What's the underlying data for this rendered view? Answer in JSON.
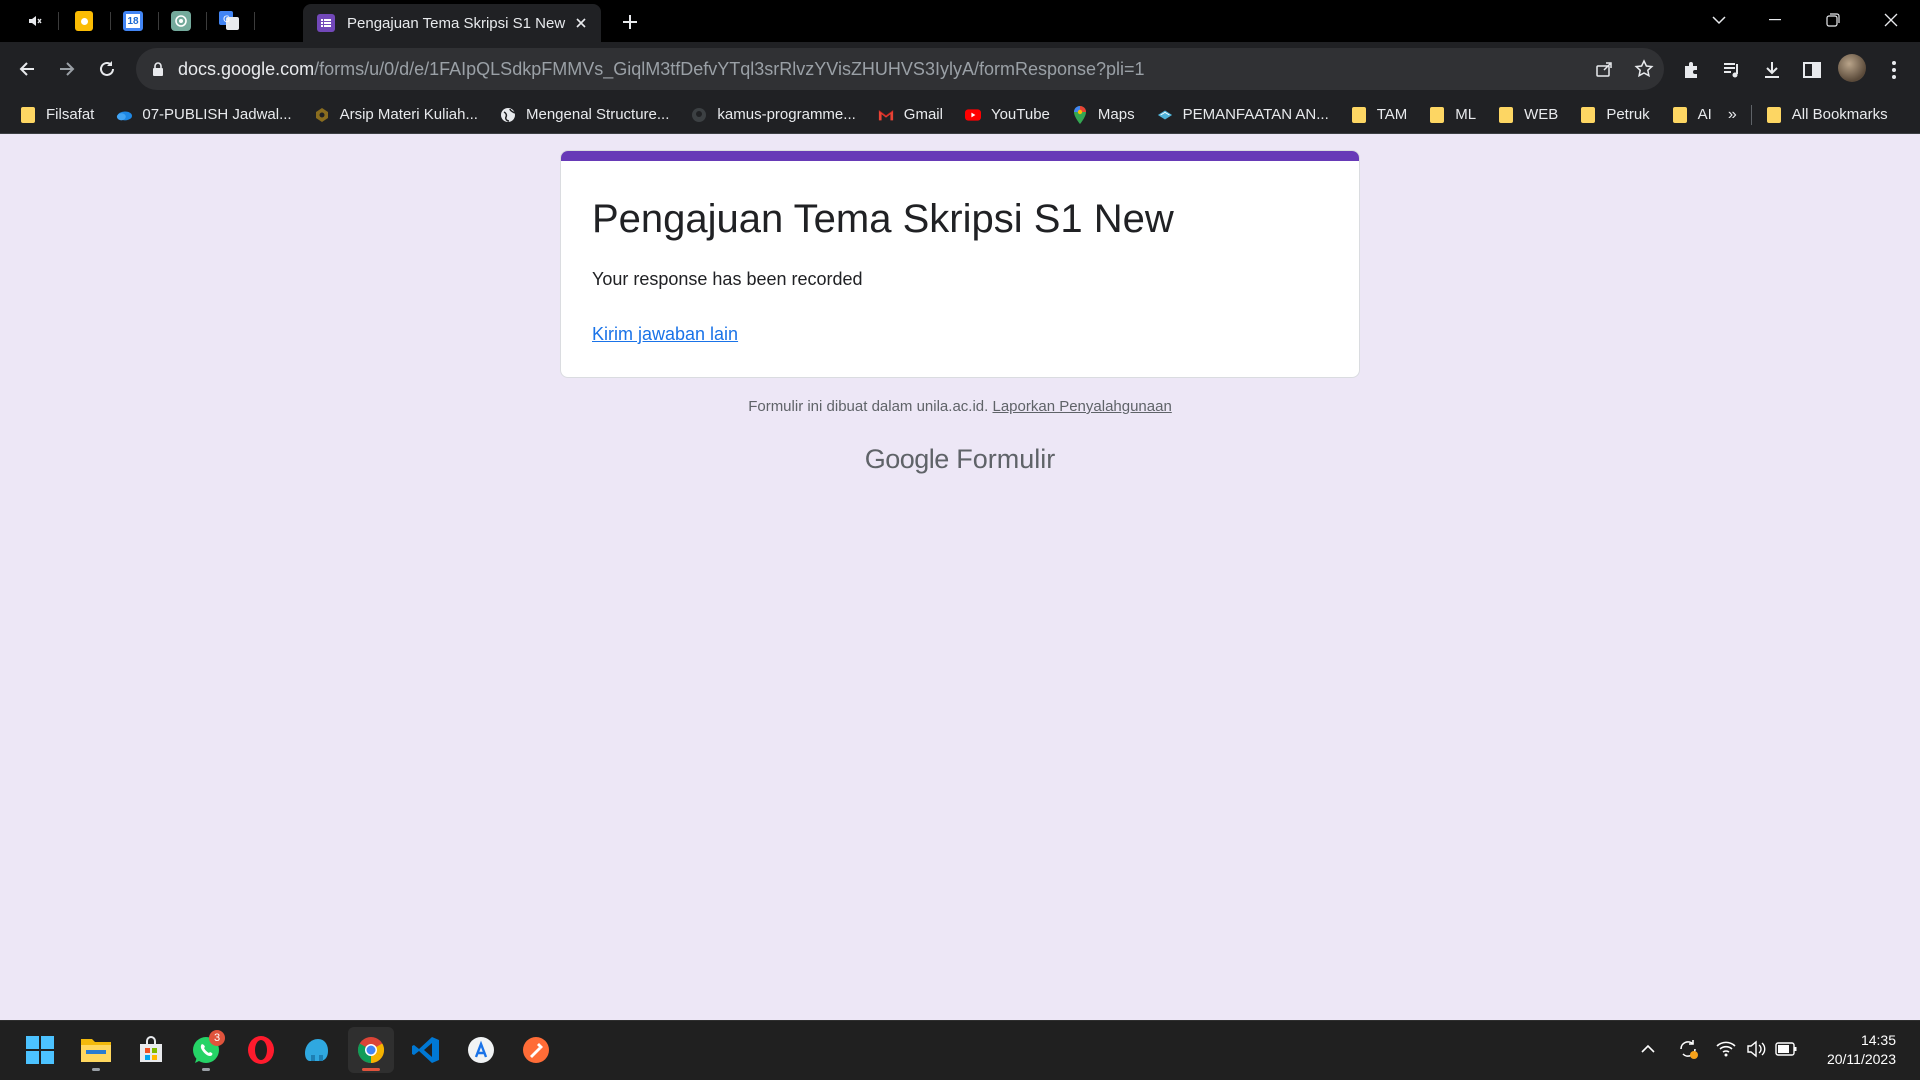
{
  "browser": {
    "active_tab_title": "Pengajuan Tema Skripsi S1 New",
    "url_host": "docs.google.com",
    "url_path": "/forms/u/0/d/e/1FAIpQLSdkpFMMVs_GiqlM3tfDefvYTql3srRlvzYVisZHUHVS3IylyA/formResponse?pli=1",
    "pinned_tabs": [
      "audio-muted-icon",
      "keep-icon",
      "calendar-icon",
      "chatgpt-icon",
      "translate-icon"
    ],
    "calendar_day": "18"
  },
  "bookmarks": [
    {
      "label": "Filsafat",
      "icon": "folder-icon"
    },
    {
      "label": "07-PUBLISH Jadwal...",
      "icon": "onedrive-icon"
    },
    {
      "label": "Arsip Materi Kuliah...",
      "icon": "site-icon"
    },
    {
      "label": "Mengenal Structure...",
      "icon": "globe-icon"
    },
    {
      "label": "kamus-programme...",
      "icon": "github-icon"
    },
    {
      "label": "Gmail",
      "icon": "gmail-icon"
    },
    {
      "label": "YouTube",
      "icon": "youtube-icon"
    },
    {
      "label": "Maps",
      "icon": "maps-icon"
    },
    {
      "label": "PEMANFAATAN AN...",
      "icon": "site-icon"
    },
    {
      "label": "TAM",
      "icon": "folder-icon"
    },
    {
      "label": "ML",
      "icon": "folder-icon"
    },
    {
      "label": "WEB",
      "icon": "folder-icon"
    },
    {
      "label": "Petruk",
      "icon": "folder-icon"
    },
    {
      "label": "AI",
      "icon": "folder-icon"
    }
  ],
  "bookmarks_overflow": "»",
  "all_bookmarks": "All Bookmarks",
  "form": {
    "title": "Pengajuan Tema Skripsi S1 New",
    "message": "Your response has been recorded",
    "link": "Kirim jawaban lain",
    "footer_note": "Formulir ini dibuat dalam unila.ac.id.",
    "abuse_link": "Laporkan Penyalahgunaan",
    "brand_google": "Google",
    "brand_product": "Formulir",
    "accent_color": "#673ab7"
  },
  "taskbar": {
    "apps": [
      "windows-start-icon",
      "file-explorer-icon",
      "microsoft-store-icon",
      "whatsapp-icon",
      "opera-icon",
      "app-icon",
      "chrome-icon",
      "vscode-icon",
      "app-store-icon",
      "postman-icon"
    ],
    "whatsapp_badge": "3",
    "time": "14:35",
    "date": "20/11/2023"
  }
}
